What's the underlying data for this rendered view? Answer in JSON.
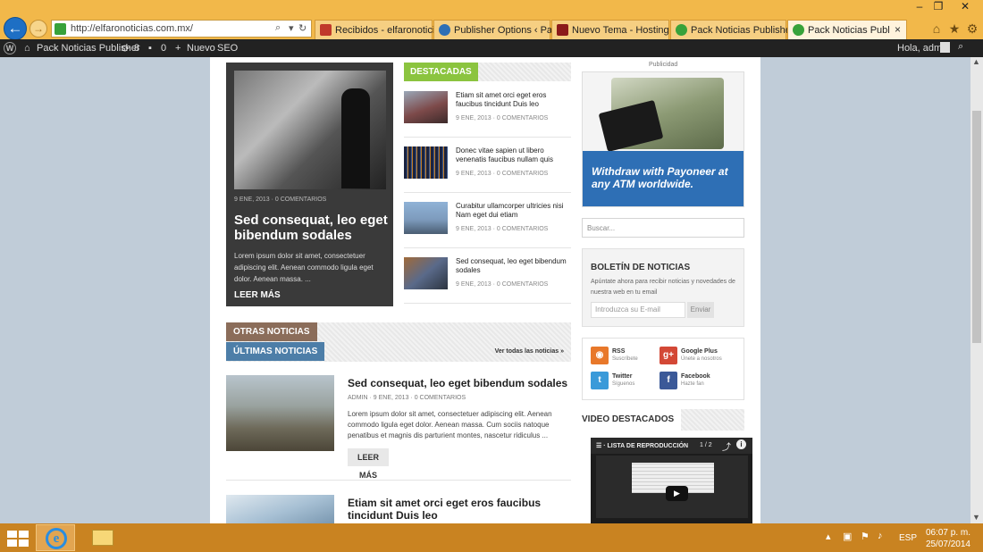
{
  "browser": {
    "url": "http://elfaronoticias.com.mx/",
    "tabs": [
      {
        "label": "Recibidos - elfaronotici...",
        "color": "#c0392b"
      },
      {
        "label": "Publisher Options ‹ Pac...",
        "color": "#2e6fb5"
      },
      {
        "label": "Nuevo Tema - Hosting ...",
        "color": "#8b1a1a"
      },
      {
        "label": "Pack Noticias Publisher |",
        "color": "#38a23a"
      },
      {
        "label": "Pack Noticias Publis...",
        "color": "#38a23a"
      }
    ],
    "tab_close": "×",
    "back_glyph": "←",
    "forward_glyph": "→",
    "window_minimize": "–",
    "window_restore": "❐",
    "window_close": "✕"
  },
  "adminbar": {
    "site_name": "Pack Noticias Publisher",
    "updates_count": "8",
    "comments_count": "0",
    "new_label": "Nuevo",
    "seo_label": "SEO",
    "greeting": "Hola, admin"
  },
  "featured": {
    "meta": "9 ENE, 2013 · 0 COMENTARIOS",
    "title": "Sed consequat, leo eget bibendum sodales",
    "excerpt": "Lorem ipsum dolor sit amet, consectetuer adipiscing elit. Aenean commodo ligula eget dolor. Aenean massa. ...",
    "more": "LEER MÁS"
  },
  "destacadas": {
    "label": "DESTACADAS",
    "items": [
      {
        "title": "Etiam sit amet orci eget eros faucibus tincidunt Duis leo",
        "meta": "9 ENE, 2013 · 0 COMENTARIOS"
      },
      {
        "title": "Donec vitae sapien ut libero venenatis faucibus nullam quis",
        "meta": "9 ENE, 2013 · 0 COMENTARIOS"
      },
      {
        "title": "Curabitur ullamcorper ultricies nisi Nam eget dui etiam",
        "meta": "9 ENE, 2013 · 0 COMENTARIOS"
      },
      {
        "title": "Sed consequat, leo eget bibendum sodales",
        "meta": "9 ENE, 2013 · 0 COMENTARIOS"
      }
    ]
  },
  "otras": {
    "otras_label": "OTRAS NOTICIAS",
    "ultimas_label": "ÚLTIMAS NOTICIAS",
    "ver_todas": "Ver todas las noticias »"
  },
  "articles": [
    {
      "title": "Sed consequat, leo eget bibendum sodales",
      "meta": "ADMIN · 9 ENE, 2013 · 0 COMENTARIOS",
      "excerpt": "Lorem ipsum dolor sit amet, consectetuer adipiscing elit. Aenean commodo ligula eget dolor. Aenean massa. Cum sociis natoque penatibus et magnis dis parturient montes, nascetur ridiculus ...",
      "more": "LEER MÁS"
    },
    {
      "title": "Etiam sit amet orci eget eros faucibus tincidunt Duis leo"
    }
  ],
  "sidebar": {
    "publicidad": "Publicidad",
    "ad_text": "Withdraw with Payoneer at any ATM worldwide.",
    "search_placeholder": "Buscar...",
    "newsletter": {
      "title": "BOLETÍN DE NOTICIAS",
      "desc": "Apúntate ahora para recibir noticias y novedades de nuestra web en tu email",
      "input_placeholder": "Introduzca su E-mail",
      "button": "Enviar"
    },
    "social": [
      {
        "name": "RSS",
        "sub": "Suscríbete",
        "color": "#e8782a",
        "glyph": "◉"
      },
      {
        "name": "Google Plus",
        "sub": "Únete a nosotros",
        "color": "#d34836",
        "glyph": "g+"
      },
      {
        "name": "Twitter",
        "sub": "Síguenos",
        "color": "#3a9ad9",
        "glyph": "t"
      },
      {
        "name": "Facebook",
        "sub": "Hazte fan",
        "color": "#3b5998",
        "glyph": "f"
      }
    ],
    "video_title": "VIDEO DESTACADOS",
    "video_playlist": "LISTA DE REPRODUCCIÓN",
    "video_counter": "1 / 2"
  },
  "taskbar": {
    "lang": "ESP",
    "time": "06:07 p. m.",
    "date": "25/07/2014"
  },
  "colors": {
    "chrome": "#f2b84a",
    "destacadas": "#8bc43f",
    "otras": "#8b6d5a",
    "ultimas": "#4d7ea8",
    "taskbar": "#c98321"
  }
}
